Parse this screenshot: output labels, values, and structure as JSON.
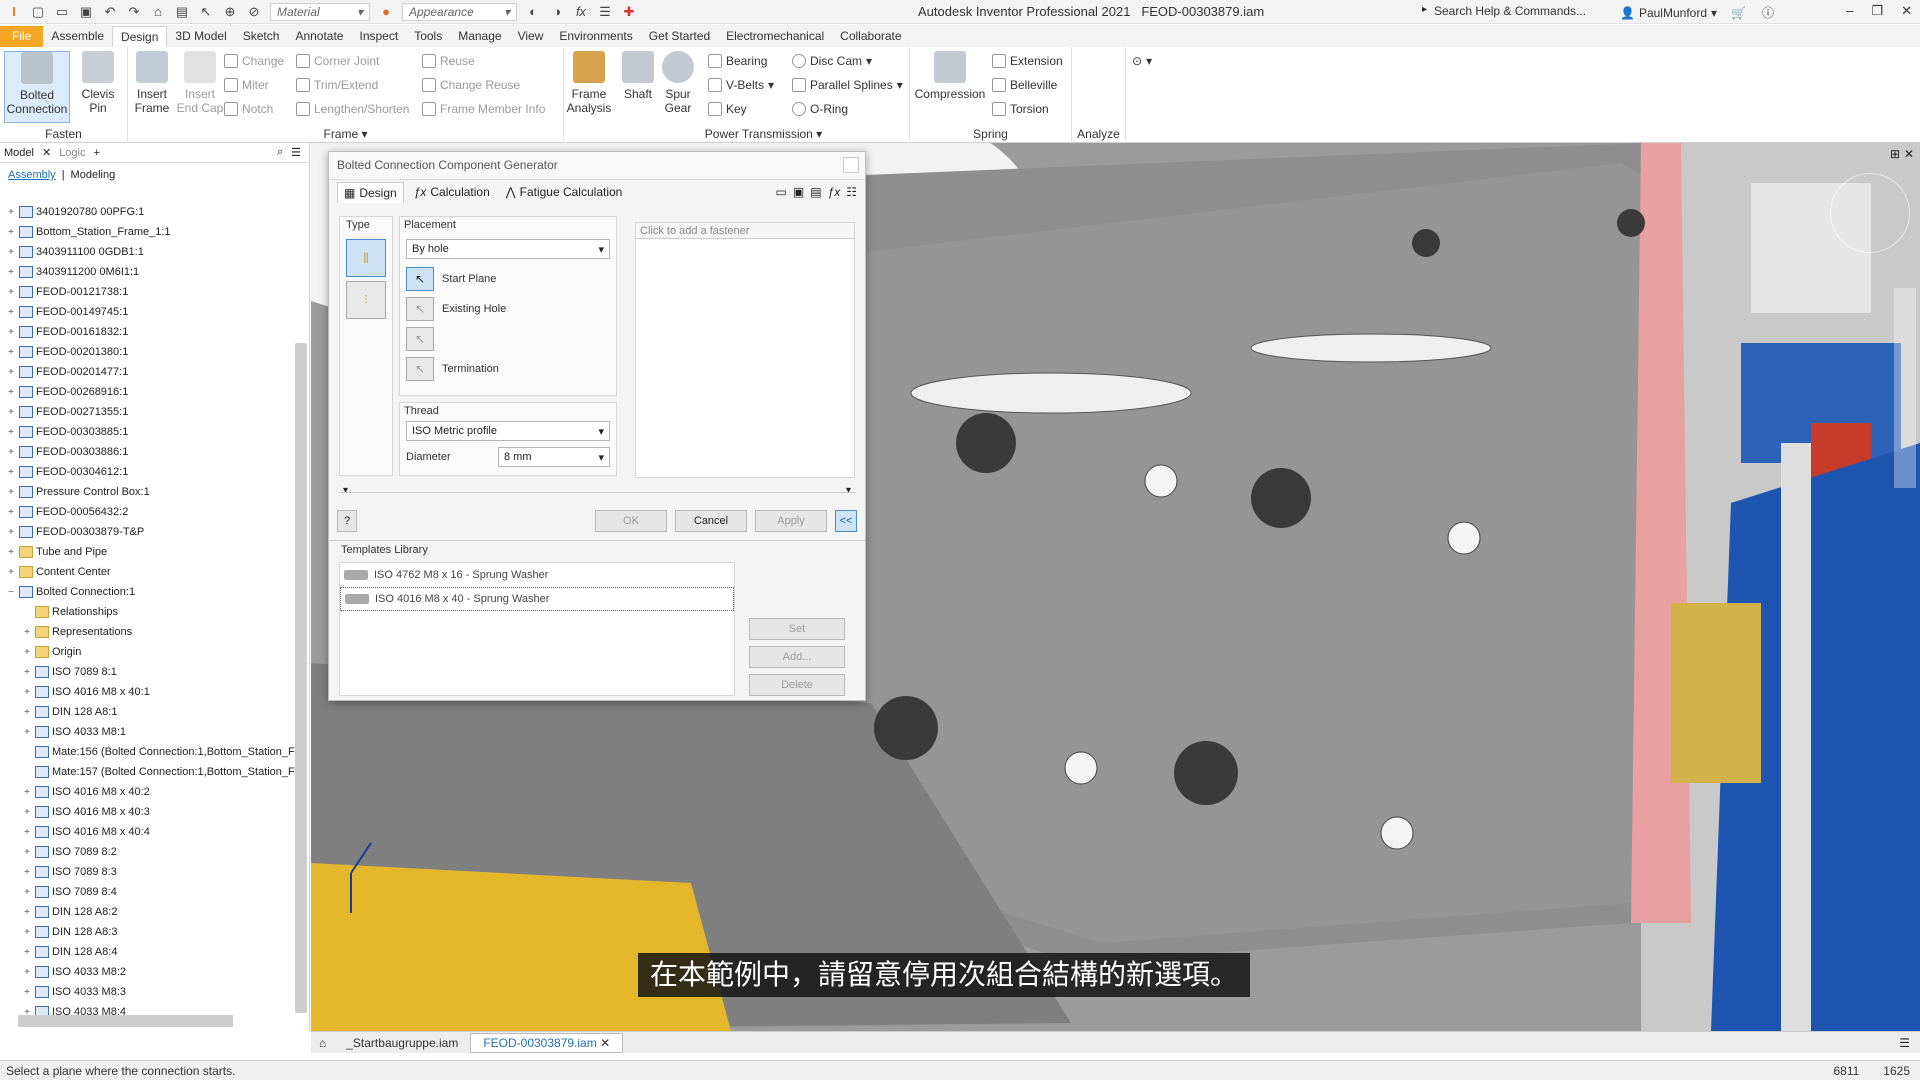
{
  "titlebar": {
    "material_placeholder": "Material",
    "appearance_placeholder": "Appearance",
    "app_title": "Autodesk Inventor Professional 2021",
    "doc_title": "FEOD-00303879.iam",
    "search_placeholder": "Search Help & Commands...",
    "user": "PaulMunford"
  },
  "ribbon_tabs": [
    "File",
    "Assemble",
    "Design",
    "3D Model",
    "Sketch",
    "Annotate",
    "Inspect",
    "Tools",
    "Manage",
    "View",
    "Environments",
    "Get Started",
    "Electromechanical",
    "Collaborate"
  ],
  "ribbon": {
    "fasten": {
      "title": "Fasten",
      "bolted": "Bolted\nConnection",
      "clevis": "Clevis\nPin"
    },
    "frame": {
      "title": "Frame",
      "insert": "Insert\nFrame",
      "insert_end": "Insert\nEnd Cap",
      "change": "Change",
      "miter": "Miter",
      "notch": "Notch",
      "corner": "Corner Joint",
      "trim": "Trim/Extend",
      "lengthen": "Lengthen/Shorten",
      "reuse": "Reuse",
      "change_reuse": "Change Reuse",
      "member_info": "Frame Member Info",
      "analysis": "Frame\nAnalysis"
    },
    "power": {
      "title": "Power Transmission",
      "shaft": "Shaft",
      "spur": "Spur\nGear",
      "bearing": "Bearing",
      "vbelts": "V-Belts",
      "key": "Key",
      "disc_cam": "Disc Cam",
      "parallel_splines": "Parallel Splines",
      "oring": "O-Ring"
    },
    "spring": {
      "title": "Spring",
      "compression": "Compression",
      "extension": "Extension",
      "belleville": "Belleville",
      "torsion": "Torsion"
    },
    "analyze": {
      "title": "Analyze"
    }
  },
  "browser": {
    "tab_model": "Model",
    "tab_logic": "Logic",
    "sub_assembly": "Assembly",
    "sub_modeling": "Modeling",
    "items": [
      {
        "label": "3401920780 00PFG:1",
        "depth": 0,
        "exp": "+",
        "type": "part"
      },
      {
        "label": "Bottom_Station_Frame_1:1",
        "depth": 0,
        "exp": "+",
        "type": "part"
      },
      {
        "label": "3403911100 0GDB1:1",
        "depth": 0,
        "exp": "+",
        "type": "part"
      },
      {
        "label": "3403911200 0M6I1:1",
        "depth": 0,
        "exp": "+",
        "type": "part"
      },
      {
        "label": "FEOD-00121738:1",
        "depth": 0,
        "exp": "+",
        "type": "part"
      },
      {
        "label": "FEOD-00149745:1",
        "depth": 0,
        "exp": "+",
        "type": "part"
      },
      {
        "label": "FEOD-00161832:1",
        "depth": 0,
        "exp": "+",
        "type": "part"
      },
      {
        "label": "FEOD-00201380:1",
        "depth": 0,
        "exp": "+",
        "type": "part"
      },
      {
        "label": "FEOD-00201477:1",
        "depth": 0,
        "exp": "+",
        "type": "part"
      },
      {
        "label": "FEOD-00268916:1",
        "depth": 0,
        "exp": "+",
        "type": "part"
      },
      {
        "label": "FEOD-00271355:1",
        "depth": 0,
        "exp": "+",
        "type": "part"
      },
      {
        "label": "FEOD-00303885:1",
        "depth": 0,
        "exp": "+",
        "type": "part"
      },
      {
        "label": "FEOD-00303886:1",
        "depth": 0,
        "exp": "+",
        "type": "part"
      },
      {
        "label": "FEOD-00304612:1",
        "depth": 0,
        "exp": "+",
        "type": "part"
      },
      {
        "label": "Pressure Control Box:1",
        "depth": 0,
        "exp": "+",
        "type": "part"
      },
      {
        "label": "FEOD-00056432:2",
        "depth": 0,
        "exp": "+",
        "type": "part"
      },
      {
        "label": "FEOD-00303879-T&P",
        "depth": 0,
        "exp": "+",
        "type": "part"
      },
      {
        "label": "Tube and Pipe",
        "depth": 0,
        "exp": "+",
        "type": "folder"
      },
      {
        "label": "Content Center",
        "depth": 0,
        "exp": "+",
        "type": "folder"
      },
      {
        "label": "Bolted Connection:1",
        "depth": 0,
        "exp": "−",
        "type": "part"
      },
      {
        "label": "Relationships",
        "depth": 1,
        "exp": "",
        "type": "folder"
      },
      {
        "label": "Representations",
        "depth": 1,
        "exp": "+",
        "type": "folder"
      },
      {
        "label": "Origin",
        "depth": 1,
        "exp": "+",
        "type": "folder"
      },
      {
        "label": "ISO 7089 8:1",
        "depth": 1,
        "exp": "+",
        "type": "part"
      },
      {
        "label": "ISO 4016 M8 x 40:1",
        "depth": 1,
        "exp": "+",
        "type": "part"
      },
      {
        "label": "DIN 128 A8:1",
        "depth": 1,
        "exp": "+",
        "type": "part"
      },
      {
        "label": "ISO 4033 M8:1",
        "depth": 1,
        "exp": "+",
        "type": "part"
      },
      {
        "label": "Mate:156 (Bolted Connection:1,Bottom_Station_F",
        "depth": 1,
        "exp": "",
        "type": "part"
      },
      {
        "label": "Mate:157 (Bolted Connection:1,Bottom_Station_F",
        "depth": 1,
        "exp": "",
        "type": "part"
      },
      {
        "label": "ISO 4016 M8 x 40:2",
        "depth": 1,
        "exp": "+",
        "type": "part"
      },
      {
        "label": "ISO 4016 M8 x 40:3",
        "depth": 1,
        "exp": "+",
        "type": "part"
      },
      {
        "label": "ISO 4016 M8 x 40:4",
        "depth": 1,
        "exp": "+",
        "type": "part"
      },
      {
        "label": "ISO 7089 8:2",
        "depth": 1,
        "exp": "+",
        "type": "part"
      },
      {
        "label": "ISO 7089 8:3",
        "depth": 1,
        "exp": "+",
        "type": "part"
      },
      {
        "label": "ISO 7089 8:4",
        "depth": 1,
        "exp": "+",
        "type": "part"
      },
      {
        "label": "DIN 128 A8:2",
        "depth": 1,
        "exp": "+",
        "type": "part"
      },
      {
        "label": "DIN 128 A8:3",
        "depth": 1,
        "exp": "+",
        "type": "part"
      },
      {
        "label": "DIN 128 A8:4",
        "depth": 1,
        "exp": "+",
        "type": "part"
      },
      {
        "label": "ISO 4033 M8:2",
        "depth": 1,
        "exp": "+",
        "type": "part"
      },
      {
        "label": "ISO 4033 M8:3",
        "depth": 1,
        "exp": "+",
        "type": "part"
      },
      {
        "label": "ISO 4033 M8:4",
        "depth": 1,
        "exp": "+",
        "type": "part"
      }
    ]
  },
  "dialog": {
    "title": "Bolted Connection Component Generator",
    "tab_design": "Design",
    "tab_calc": "Calculation",
    "tab_fatigue": "Fatigue Calculation",
    "type_label": "Type",
    "placement_label": "Placement",
    "placement_value": "By hole",
    "start_plane": "Start Plane",
    "existing_hole": "Existing Hole",
    "termination": "Termination",
    "thread_label": "Thread",
    "thread_value": "ISO Metric profile",
    "diameter_label": "Diameter",
    "diameter_value": "8 mm",
    "fastener_placeholder": "Click to add a fastener",
    "ok": "OK",
    "cancel": "Cancel",
    "apply": "Apply",
    "collapse": "<<",
    "templates_label": "Templates Library",
    "templates": [
      "ISO 4762 M8 x 16 - Sprung Washer",
      "ISO 4016 M8 x 40 - Sprung Washer"
    ],
    "set": "Set",
    "add": "Add...",
    "delete": "Delete"
  },
  "doctabs": [
    "_Startbaugruppe.iam",
    "FEOD-00303879.iam"
  ],
  "status": {
    "text": "Select a plane where the connection starts.",
    "n1": "6811",
    "n2": "1625"
  },
  "subtitle": "在本範例中，請留意停用次組合結構的新選項。",
  "colors": {
    "accent": "#f5a623",
    "link": "#1e6fb8"
  }
}
